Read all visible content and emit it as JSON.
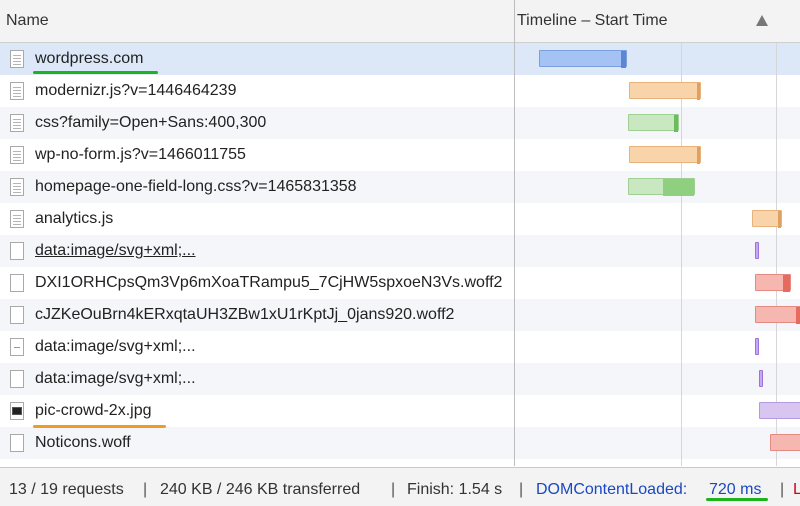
{
  "header": {
    "name_label": "Name",
    "timeline_label": "Timeline – Start Time",
    "sort_icon": "triangle-up-icon"
  },
  "rows": [
    {
      "name": "wordpress.com",
      "icon": "document-icon",
      "selected": true
    },
    {
      "name": "modernizr.js?v=1446464239",
      "icon": "document-icon"
    },
    {
      "name": "css?family=Open+Sans:400,300",
      "icon": "document-icon"
    },
    {
      "name": "wp-no-form.js?v=1466011755",
      "icon": "document-icon"
    },
    {
      "name": "homepage-one-field-long.css?v=1465831358",
      "icon": "document-icon"
    },
    {
      "name": "analytics.js",
      "icon": "document-icon"
    },
    {
      "name": "data:image/svg+xml;...",
      "icon": "blank-file-icon"
    },
    {
      "name": "DXI1ORHCpsQm3Vp6mXoaTRampu5_7CjHW5spxoeN3Vs.woff2",
      "icon": "blank-file-icon"
    },
    {
      "name": "cJZKeOuBrn4kERxqtaUH3ZBw1xU1rKptJj_0jans920.woff2",
      "icon": "blank-file-icon"
    },
    {
      "name": "data:image/svg+xml;...",
      "icon": "svg-file-icon"
    },
    {
      "name": "data:image/svg+xml;...",
      "icon": "blank-file-icon"
    },
    {
      "name": "pic-crowd-2x.jpg",
      "icon": "image-file-icon"
    },
    {
      "name": "Noticons.woff",
      "icon": "blank-file-icon"
    }
  ],
  "colors": {
    "document": "#a4c2f4",
    "script": "#f9d3aa",
    "stylesheet": "#c9e8c2",
    "font": "#f6b7b0",
    "image": "#d8c6f1",
    "highlight_green": "#1db31d",
    "highlight_orange": "#f29b22"
  },
  "footer": {
    "requests": "13 / 19 requests",
    "transferred": "240 KB / 246 KB transferred",
    "finish": "Finish: 1.54 s",
    "dcl_label": "DOMContentLoaded:",
    "dcl_value": "720 ms",
    "load_label": "L"
  }
}
